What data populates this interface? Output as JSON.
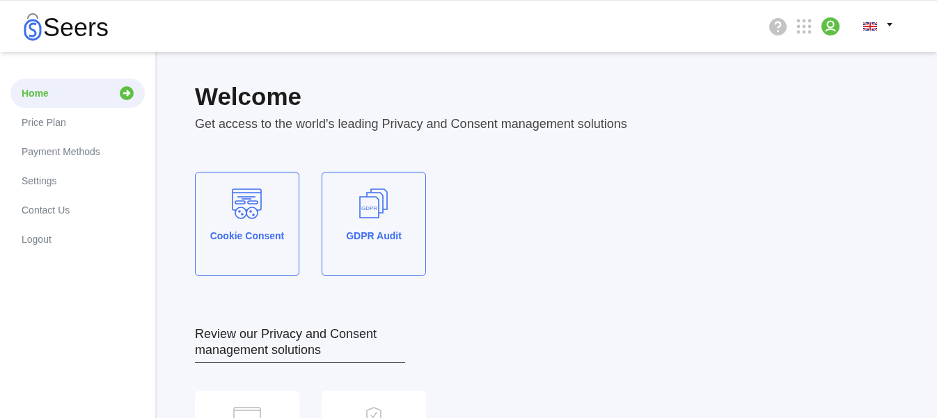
{
  "header": {
    "brand": "Seers"
  },
  "sidebar": {
    "items": [
      {
        "label": "Home",
        "selected": true
      },
      {
        "label": "Price Plan",
        "selected": false
      },
      {
        "label": "Payment Methods",
        "selected": false
      },
      {
        "label": "Settings",
        "selected": false
      },
      {
        "label": "Contact Us",
        "selected": false
      },
      {
        "label": "Logout",
        "selected": false
      }
    ]
  },
  "main": {
    "title": "Welcome",
    "subtitle": "Get access to the world's leading Privacy and Consent management solutions",
    "products": [
      {
        "label": "Cookie Consent"
      },
      {
        "label": "GDPR Audit",
        "icon_text": "GDPR"
      }
    ],
    "review_heading": "Review our Privacy and Consent management solutions"
  }
}
